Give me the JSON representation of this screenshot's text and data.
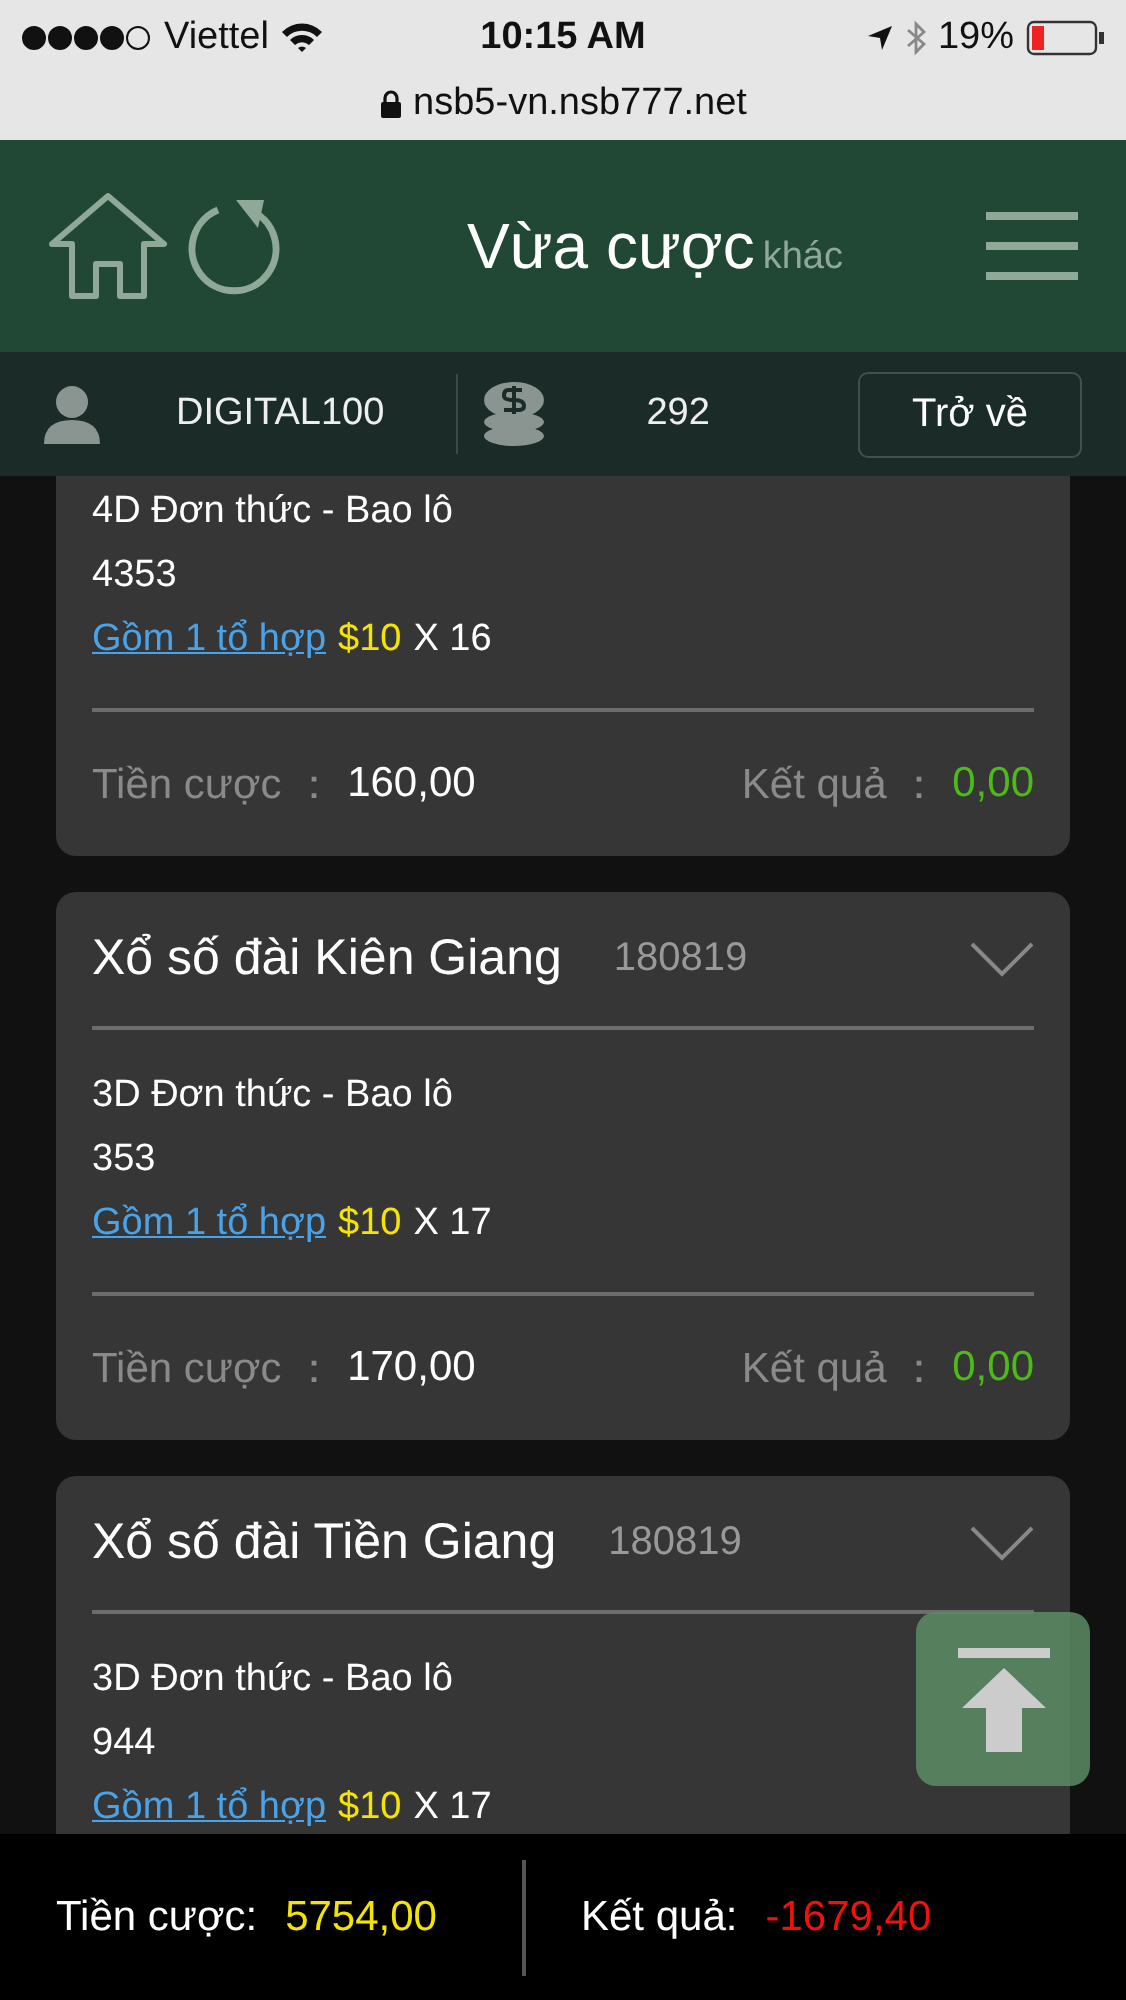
{
  "status_bar": {
    "carrier": "Viettel",
    "time": "10:15 AM",
    "battery": "19%"
  },
  "browser": {
    "url": "nsb5-vn.nsb777.net"
  },
  "header": {
    "title": "Vừa cược",
    "subtitle": "khác"
  },
  "user_bar": {
    "username": "DIGITAL100",
    "balance": "292",
    "back_button": "Trở về"
  },
  "bets": [
    {
      "bet_type": "4D Đơn thức - Bao lô",
      "numbers": "4353",
      "combo_link": "Gồm 1 tổ hợp",
      "unit_price": "$10",
      "multiplier": "X 16",
      "stake_label": "Tiền cược ：",
      "stake": "160,00",
      "result_label": "Kết quả ：",
      "result": "0,00"
    },
    {
      "lottery": "Xổ số đài Kiên Giang",
      "draw": "180819",
      "bet_type": "3D Đơn thức - Bao lô",
      "numbers": "353",
      "combo_link": "Gồm 1 tổ hợp",
      "unit_price": "$10",
      "multiplier": "X 17",
      "stake_label": "Tiền cược ：",
      "stake": "170,00",
      "result_label": "Kết quả ：",
      "result": "0,00"
    },
    {
      "lottery": "Xổ số đài Tiền Giang",
      "draw": "180819",
      "bet_type": "3D Đơn thức - Bao lô",
      "numbers": "944",
      "combo_link": "Gồm 1 tổ hợp",
      "unit_price": "$10",
      "multiplier": "X 17"
    }
  ],
  "totals": {
    "stake_label": "Tiền cược:",
    "stake": "5754,00",
    "result_label": "Kết quả:",
    "result": "-1679,40"
  }
}
